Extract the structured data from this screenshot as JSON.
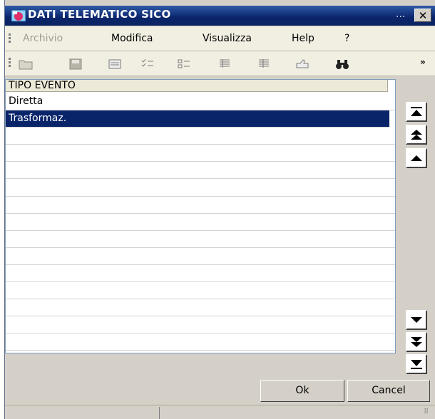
{
  "window": {
    "title": "DATI TELEMATICO SICO",
    "title_dots": "..."
  },
  "menu": {
    "items": [
      {
        "label": "Archivio",
        "disabled": true
      },
      {
        "label": "Modifica",
        "disabled": false
      },
      {
        "label": "Visualizza",
        "disabled": false
      },
      {
        "label": "Help",
        "disabled": false
      },
      {
        "label": "?",
        "disabled": false
      }
    ]
  },
  "toolbar": {
    "icons": [
      "open-folder-icon",
      "save-icon",
      "form-view-icon",
      "checklist-icon",
      "list-view-icon",
      "details-view-icon",
      "report-view-icon",
      "thumbs-up-icon",
      "binoculars-icon"
    ],
    "overflow_glyph": "»"
  },
  "list": {
    "header": "TIPO EVENTO",
    "rows": [
      "Diretta",
      "Trasformaz.",
      "",
      "",
      "",
      "",
      "",
      "",
      "",
      "",
      "",
      "",
      "",
      "",
      "",
      ""
    ],
    "selected_index": 1
  },
  "buttons": {
    "ok": "Ok",
    "cancel": "Cancel"
  },
  "colors": {
    "title_bar": "#0a246a",
    "selection": "#0a246a",
    "menu_bg": "#f1efe2"
  }
}
